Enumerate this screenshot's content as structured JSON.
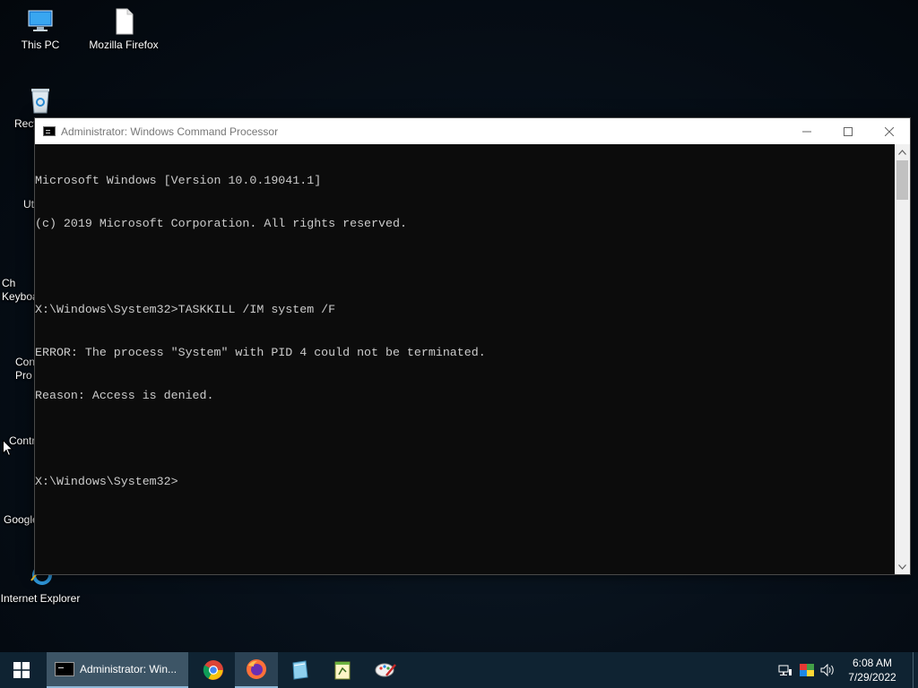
{
  "desktop": {
    "icons": [
      {
        "name": "this-pc",
        "label": "This PC"
      },
      {
        "name": "mozilla-firefox",
        "label": "Mozilla Firefox"
      },
      {
        "name": "recycle-bin",
        "label": "Recy"
      },
      {
        "name": "utilities",
        "label": "Ut"
      },
      {
        "name": "keyboard",
        "label": "Ch\nKeyboa"
      },
      {
        "name": "command-prompt",
        "label": "Con\nPro"
      },
      {
        "name": "control-panel",
        "label": "Contr"
      },
      {
        "name": "google",
        "label": "Google"
      },
      {
        "name": "internet-explorer",
        "label": "Internet Explorer"
      }
    ]
  },
  "window": {
    "title": "Administrator: Windows Command Processor",
    "controls": {
      "minimize": "minimize",
      "maximize": "maximize",
      "close": "close"
    },
    "console_lines": [
      "Microsoft Windows [Version 10.0.19041.1]",
      "(c) 2019 Microsoft Corporation. All rights reserved.",
      "",
      "X:\\Windows\\System32>TASKKILL /IM system /F",
      "ERROR: The process \"System\" with PID 4 could not be terminated.",
      "Reason: Access is denied.",
      "",
      "X:\\Windows\\System32>"
    ]
  },
  "taskbar": {
    "active_task_label": "Administrator: Win...",
    "pinned": [
      "chrome-icon",
      "firefox-icon",
      "paint-icon",
      "notepad-icon",
      "paint-brush-icon"
    ],
    "clock": {
      "time": "6:08 AM",
      "date": "7/29/2022"
    }
  },
  "colors": {
    "console_bg": "#0c0c0c",
    "console_text": "#cccccc",
    "taskbar_bg": "#0f2332",
    "active_task_bg": "#3d5566"
  }
}
